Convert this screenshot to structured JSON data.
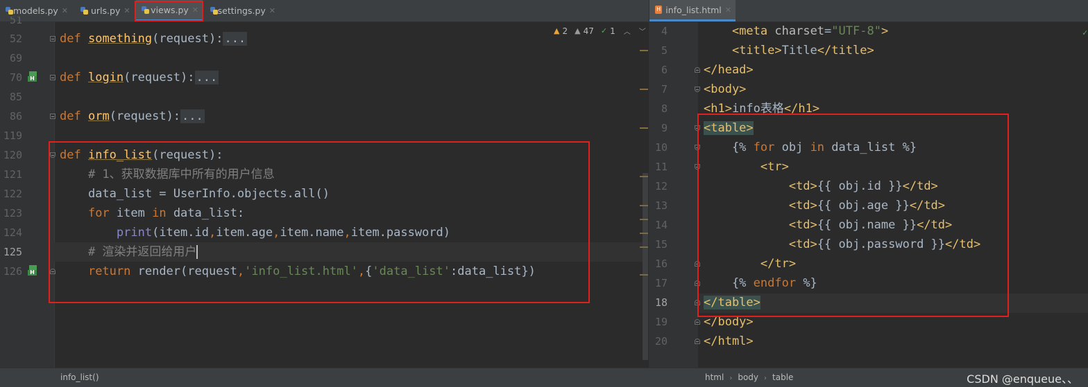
{
  "left_tabs": [
    {
      "label": "models.py",
      "active": false
    },
    {
      "label": "urls.py",
      "active": false
    },
    {
      "label": "views.py",
      "active": true
    },
    {
      "label": "settings.py",
      "active": false
    }
  ],
  "right_tabs": [
    {
      "label": "info_list.html",
      "active": true
    }
  ],
  "inspection": {
    "warnings": "2",
    "weak_warnings": "47",
    "typos": "1"
  },
  "left_editor": {
    "partial_top_line": "51",
    "lines": [
      {
        "num": "52",
        "text": "def something(request):..."
      },
      {
        "num": "69",
        "text": ""
      },
      {
        "num": "70",
        "text": "def login(request):..."
      },
      {
        "num": "85",
        "text": ""
      },
      {
        "num": "86",
        "text": "def orm(request):..."
      },
      {
        "num": "119",
        "text": ""
      },
      {
        "num": "120",
        "text": "def info_list(request):"
      },
      {
        "num": "121",
        "text": "    # 1、获取数据库中所有的用户信息"
      },
      {
        "num": "122",
        "text": "    data_list = UserInfo.objects.all()"
      },
      {
        "num": "123",
        "text": "    for item in data_list:"
      },
      {
        "num": "124",
        "text": "        print(item.id,item.age,item.name,item.password)"
      },
      {
        "num": "125",
        "text": "    # 渲染并返回给用户"
      },
      {
        "num": "126",
        "text": "    return render(request,'info_list.html',{'data_list':data_list})"
      }
    ],
    "current_line": "125",
    "breadcrumb": "info_list()"
  },
  "right_editor": {
    "lines": [
      {
        "num": "4",
        "text": "    <meta charset=\"UTF-8\">"
      },
      {
        "num": "5",
        "text": "    <title>Title</title>"
      },
      {
        "num": "6",
        "text": "</head>"
      },
      {
        "num": "7",
        "text": "<body>"
      },
      {
        "num": "8",
        "text": "<h1>info表格</h1>"
      },
      {
        "num": "9",
        "text": "<table>"
      },
      {
        "num": "10",
        "text": "    {% for obj in data_list %}"
      },
      {
        "num": "11",
        "text": "        <tr>"
      },
      {
        "num": "12",
        "text": "            <td>{{ obj.id }}</td>"
      },
      {
        "num": "13",
        "text": "            <td>{{ obj.age }}</td>"
      },
      {
        "num": "14",
        "text": "            <td>{{ obj.name }}</td>"
      },
      {
        "num": "15",
        "text": "            <td>{{ obj.password }}</td>"
      },
      {
        "num": "16",
        "text": "        </tr>"
      },
      {
        "num": "17",
        "text": "    {% endfor %}"
      },
      {
        "num": "18",
        "text": "</table>"
      },
      {
        "num": "19",
        "text": "</body>"
      },
      {
        "num": "20",
        "text": "</html>"
      }
    ],
    "current_line": "18",
    "breadcrumb": [
      "html",
      "body",
      "table"
    ]
  },
  "watermark": "CSDN @enqueue、、",
  "colors": {
    "annotation_red": "#e0201c",
    "keyword": "#cc7832",
    "function": "#ffc66d",
    "string": "#6a8759",
    "tag": "#e8bf6a",
    "comment": "#808080"
  }
}
